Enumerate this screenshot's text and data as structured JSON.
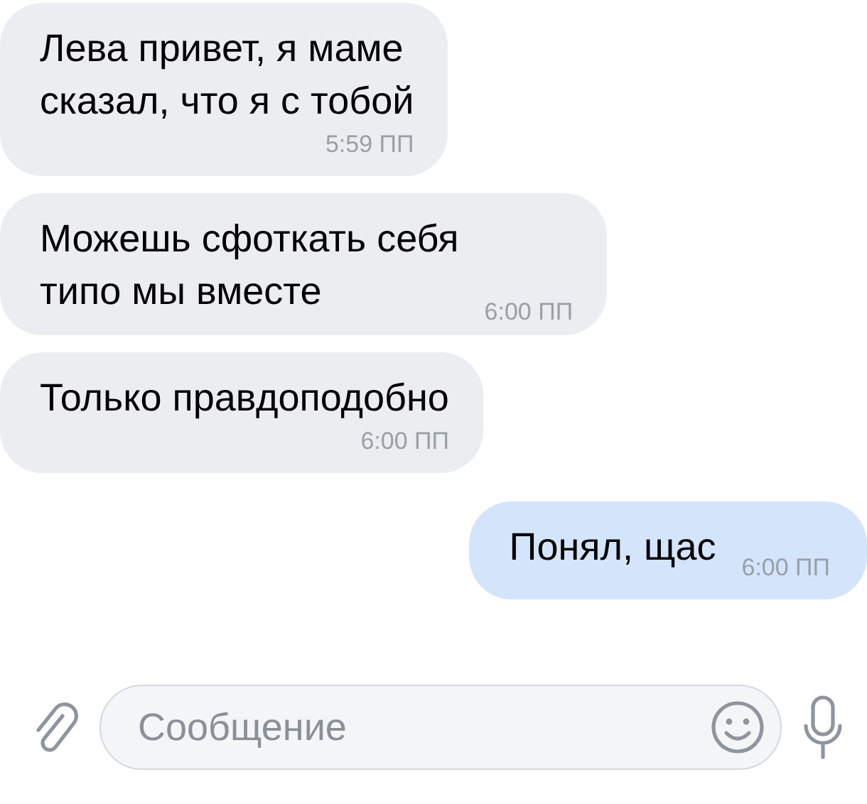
{
  "messages": [
    {
      "outgoing": false,
      "kind": "stacked",
      "lines": [
        "Лева привет, я маме",
        "сказал, что я с тобой"
      ],
      "time": "5:59 ПП"
    },
    {
      "outgoing": false,
      "kind": "inline",
      "lines": [
        "Можешь сфоткать себя",
        "типо мы вместе"
      ],
      "time": "6:00 ПП"
    },
    {
      "outgoing": false,
      "kind": "stacked",
      "lines": [
        "Только правдоподобно"
      ],
      "time": "6:00 ПП"
    },
    {
      "outgoing": true,
      "kind": "inline",
      "lines": [
        "Понял, щас"
      ],
      "time": "6:00 ПП"
    }
  ],
  "composer": {
    "placeholder": "Сообщение"
  }
}
